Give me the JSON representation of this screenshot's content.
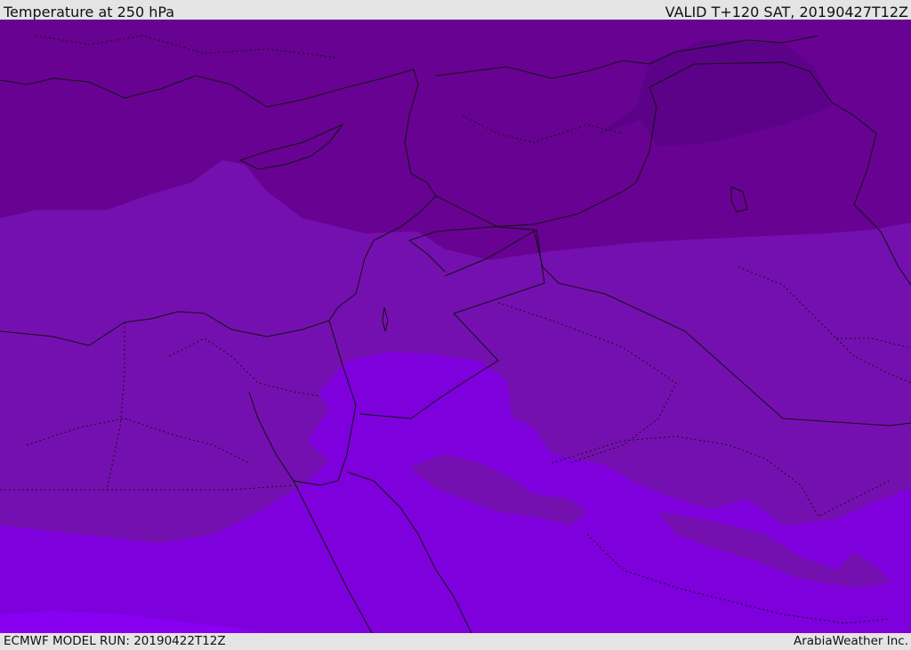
{
  "header": {
    "title": "Temperature at 250 hPa",
    "valid_time": "VALID T+120 SAT, 20190427T12Z"
  },
  "footer": {
    "model_run": "ECMWF MODEL RUN: 20190422T12Z",
    "credit": "ArabiaWeather Inc."
  },
  "colors": {
    "coldest_band": "#5c0289",
    "cold_band": "#680292",
    "mid_band": "#7510b0",
    "warm_band": "#7e00dc",
    "warmest_band": "#8800f2",
    "borders": "#111111"
  }
}
